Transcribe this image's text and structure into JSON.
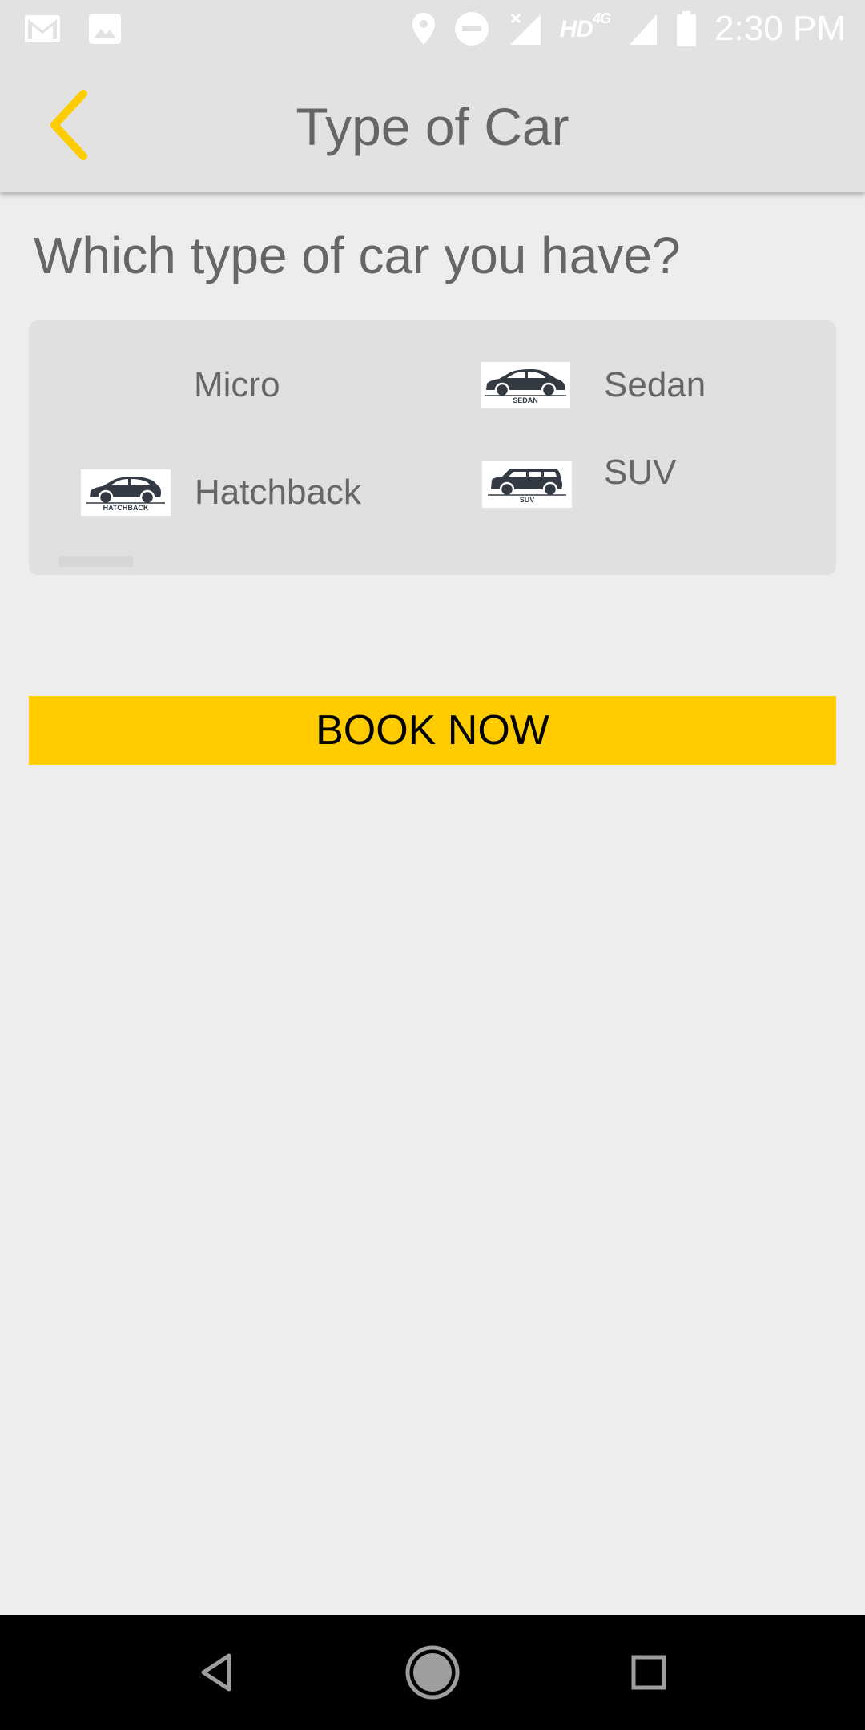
{
  "status_bar": {
    "time": "2:30 PM",
    "network_label": "HD",
    "network_type": "4G",
    "icons": [
      "gmail-icon",
      "gallery-icon",
      "location-icon",
      "do-not-disturb-icon",
      "signal-icon",
      "signal-4g-icon",
      "battery-icon"
    ]
  },
  "app_bar": {
    "title": "Type of Car",
    "back_icon": "chevron-left-icon"
  },
  "question": "Which type of car you have?",
  "options": {
    "micro": {
      "label": "Micro"
    },
    "sedan": {
      "label": "Sedan",
      "image_caption": "SEDAN"
    },
    "hatchback": {
      "label": "Hatchback",
      "image_caption": "HATCHBACK"
    },
    "suv": {
      "label": "SUV",
      "image_caption": "SUV"
    }
  },
  "book_button": {
    "label": "BOOK NOW"
  },
  "colors": {
    "accent": "#ffcc00",
    "background": "#ededed",
    "app_bar": "#e2e2e2",
    "card": "#e0e0e0",
    "text": "#666666",
    "car_silhouette": "#333a44"
  },
  "nav_bar": {
    "icons": [
      "back-triangle-icon",
      "home-circle-icon",
      "recents-square-icon"
    ]
  }
}
